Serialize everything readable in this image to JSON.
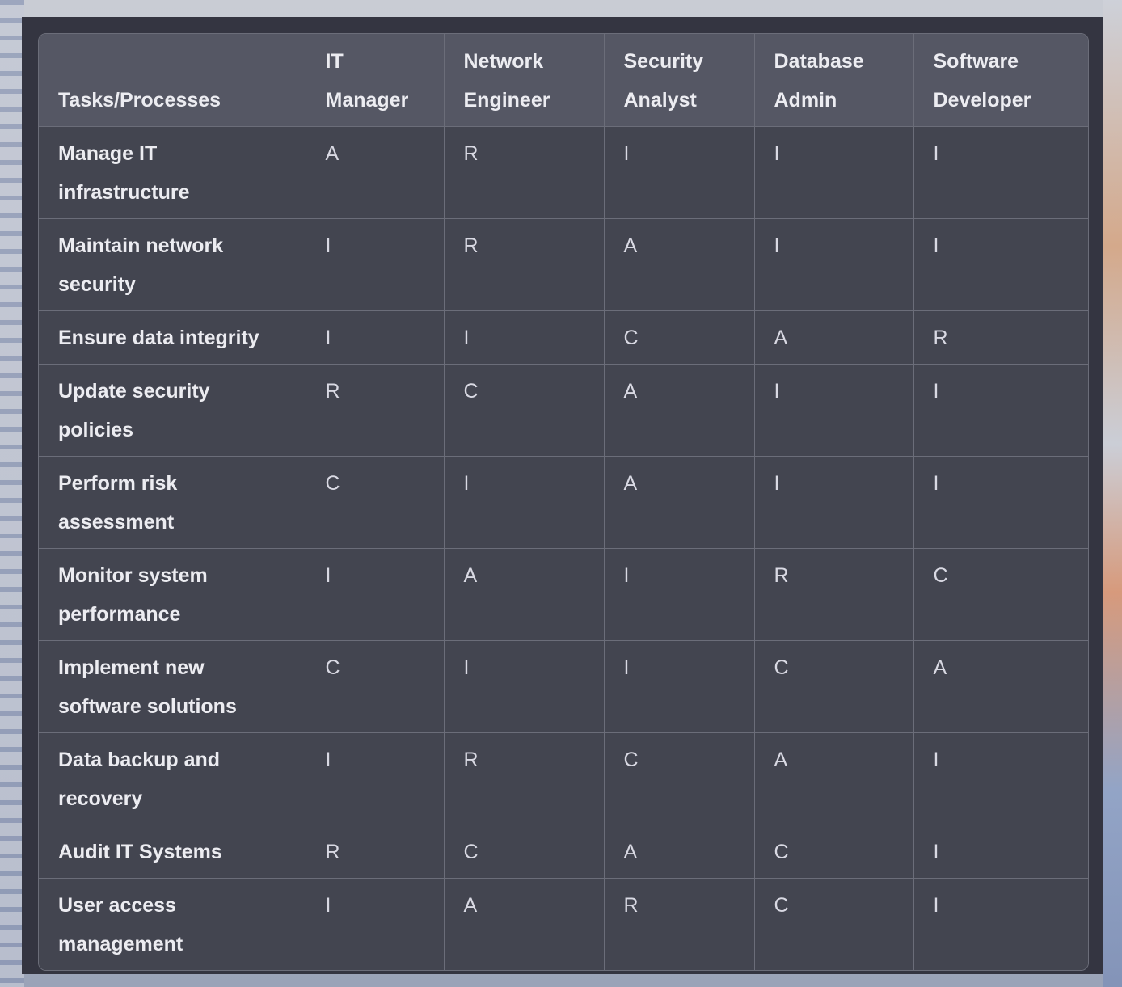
{
  "table": {
    "headers": [
      "Tasks/Processes",
      "IT Manager",
      "Network Engineer",
      "Security Analyst",
      "Database Admin",
      "Software Developer"
    ],
    "rows": [
      {
        "task": "Manage IT infrastructure",
        "values": [
          "A",
          "R",
          "I",
          "I",
          "I"
        ]
      },
      {
        "task": "Maintain network security",
        "values": [
          "I",
          "R",
          "A",
          "I",
          "I"
        ]
      },
      {
        "task": "Ensure data integrity",
        "values": [
          "I",
          "I",
          "C",
          "A",
          "R"
        ]
      },
      {
        "task": "Update security policies",
        "values": [
          "R",
          "C",
          "A",
          "I",
          "I"
        ]
      },
      {
        "task": "Perform risk assessment",
        "values": [
          "C",
          "I",
          "A",
          "I",
          "I"
        ]
      },
      {
        "task": "Monitor system performance",
        "values": [
          "I",
          "A",
          "I",
          "R",
          "C"
        ]
      },
      {
        "task": "Implement new software solutions",
        "values": [
          "C",
          "I",
          "I",
          "C",
          "A"
        ]
      },
      {
        "task": "Data backup and recovery",
        "values": [
          "I",
          "R",
          "C",
          "A",
          "I"
        ]
      },
      {
        "task": "Audit IT Systems",
        "values": [
          "R",
          "C",
          "A",
          "C",
          "I"
        ]
      },
      {
        "task": "User access management",
        "values": [
          "I",
          "A",
          "R",
          "C",
          "I"
        ]
      }
    ]
  }
}
